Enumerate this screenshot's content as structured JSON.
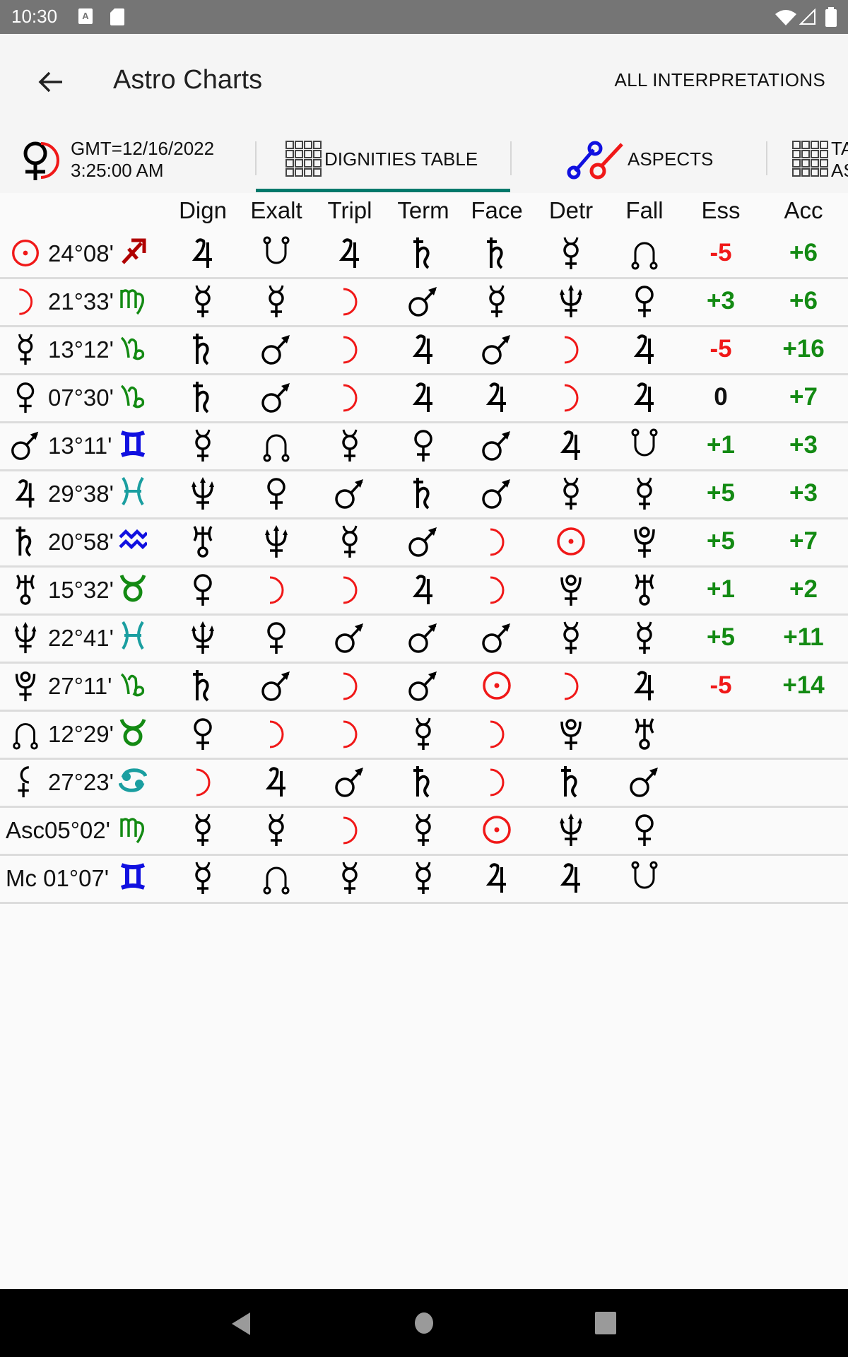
{
  "status_bar": {
    "time": "10:30",
    "left_icons": [
      "keyboard-a-icon",
      "sd-card-icon"
    ],
    "right_icons": [
      "wifi-icon",
      "cell-signal-icon",
      "battery-icon"
    ]
  },
  "app_bar": {
    "title": "Astro Charts",
    "back_icon": "arrow-left-icon",
    "action_label": "ALL INTERPRETATIONS"
  },
  "tabs": [
    {
      "label_line1": "GMT=12/16/2022",
      "label_line2": "3:25:00 AM",
      "icon": "venus-moon-chart-icon",
      "selected": false
    },
    {
      "label": "DIGNITIES TABLE",
      "icon": "grid-table-icon",
      "selected": true
    },
    {
      "label": "ASPECTS",
      "icon": "aspects-icon",
      "selected": false
    },
    {
      "label_line1": "TA",
      "label_line2": "AS",
      "icon": "grid-table-icon",
      "selected": false
    }
  ],
  "colors": {
    "accent_underline": "#00796b",
    "positive": "#138a13",
    "negative": "#f01818",
    "neutral": "#111111",
    "sun_moon": "#f01818",
    "earth_sign": "#138a13",
    "air_sign": "#1010e0",
    "water_sign": "#1a9ea0",
    "fire_sign": "#b00000"
  },
  "table": {
    "columns": [
      "Dign",
      "Exalt",
      "Tripl",
      "Term",
      "Face",
      "Detr",
      "Fall",
      "Ess",
      "Acc"
    ],
    "rows": [
      {
        "planet": "sun",
        "label": "",
        "position": "24°08'",
        "sign": "sagittarius",
        "cells": [
          "jupiter",
          "southnode",
          "jupiter",
          "saturn",
          "saturn",
          "mercury",
          "northnode"
        ],
        "ess": "-5",
        "acc": "+6"
      },
      {
        "planet": "moon",
        "label": "",
        "position": "21°33'",
        "sign": "virgo",
        "cells": [
          "mercury",
          "mercury",
          "moon",
          "mars",
          "mercury",
          "neptune",
          "venus"
        ],
        "ess": "+3",
        "acc": "+6"
      },
      {
        "planet": "mercury",
        "label": "",
        "position": "13°12'",
        "sign": "capricorn",
        "cells": [
          "saturn",
          "mars",
          "moon",
          "jupiter",
          "mars",
          "moon",
          "jupiter"
        ],
        "ess": "-5",
        "acc": "+16"
      },
      {
        "planet": "venus",
        "label": "",
        "position": "07°30'",
        "sign": "capricorn",
        "cells": [
          "saturn",
          "mars",
          "moon",
          "jupiter",
          "jupiter",
          "moon",
          "jupiter"
        ],
        "ess": "0",
        "acc": "+7"
      },
      {
        "planet": "mars",
        "label": "",
        "position": "13°11'",
        "sign": "gemini",
        "cells": [
          "mercury",
          "northnode",
          "mercury",
          "venus",
          "mars",
          "jupiter",
          "southnode"
        ],
        "ess": "+1",
        "acc": "+3"
      },
      {
        "planet": "jupiter",
        "label": "",
        "position": "29°38'",
        "sign": "pisces",
        "cells": [
          "neptune",
          "venus",
          "mars",
          "saturn",
          "mars",
          "mercury",
          "mercury"
        ],
        "ess": "+5",
        "acc": "+3"
      },
      {
        "planet": "saturn",
        "label": "",
        "position": "20°58'",
        "sign": "aquarius",
        "cells": [
          "uranus",
          "neptune",
          "mercury",
          "mars",
          "moon",
          "sun",
          "pluto"
        ],
        "ess": "+5",
        "acc": "+7"
      },
      {
        "planet": "uranus",
        "label": "",
        "position": "15°32'",
        "sign": "taurus",
        "cells": [
          "venus",
          "moon",
          "moon",
          "jupiter",
          "moon",
          "pluto",
          "uranus"
        ],
        "ess": "+1",
        "acc": "+2"
      },
      {
        "planet": "neptune",
        "label": "",
        "position": "22°41'",
        "sign": "pisces",
        "cells": [
          "neptune",
          "venus",
          "mars",
          "mars",
          "mars",
          "mercury",
          "mercury"
        ],
        "ess": "+5",
        "acc": "+11"
      },
      {
        "planet": "pluto",
        "label": "",
        "position": "27°11'",
        "sign": "capricorn",
        "cells": [
          "saturn",
          "mars",
          "moon",
          "mars",
          "sun",
          "moon",
          "jupiter"
        ],
        "ess": "-5",
        "acc": "+14"
      },
      {
        "planet": "northnode",
        "label": "",
        "position": "12°29'",
        "sign": "taurus",
        "cells": [
          "venus",
          "moon",
          "moon",
          "mercury",
          "moon",
          "pluto",
          "uranus"
        ],
        "ess": "",
        "acc": ""
      },
      {
        "planet": "lilith",
        "label": "",
        "position": "27°23'",
        "sign": "cancer",
        "cells": [
          "moon",
          "jupiter",
          "mars",
          "saturn",
          "moon",
          "saturn",
          "mars"
        ],
        "ess": "",
        "acc": ""
      },
      {
        "planet": "",
        "label": "Asc",
        "position": "05°02'",
        "sign": "virgo",
        "cells": [
          "mercury",
          "mercury",
          "moon",
          "mercury",
          "sun",
          "neptune",
          "venus"
        ],
        "ess": "",
        "acc": ""
      },
      {
        "planet": "",
        "label": "Mc ",
        "position": "01°07'",
        "sign": "gemini",
        "cells": [
          "mercury",
          "northnode",
          "mercury",
          "mercury",
          "jupiter",
          "jupiter",
          "southnode"
        ],
        "ess": "",
        "acc": ""
      }
    ]
  },
  "nav_bar": {
    "buttons": [
      "back-triangle-icon",
      "home-circle-icon",
      "recents-square-icon"
    ]
  }
}
